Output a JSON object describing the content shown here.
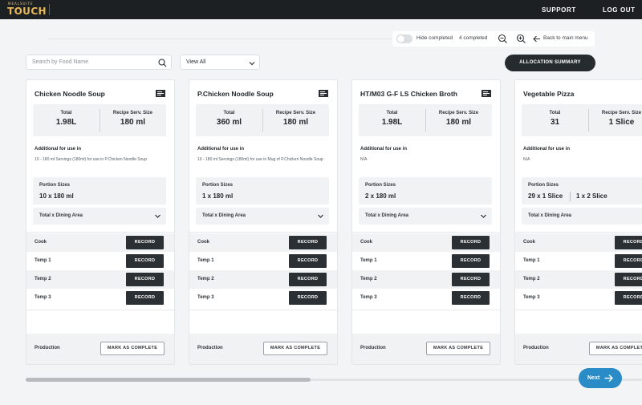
{
  "header": {
    "logo_top": "MEALSUITE",
    "logo_main": "TOUCH",
    "links": [
      "SUPPORT",
      "LOG OUT"
    ]
  },
  "toolbar": {
    "hide_completed": "Hide completed",
    "completed_count": "4 completed",
    "back": "Back to main menu"
  },
  "filters": {
    "search_placeholder": "Search by Food Name",
    "view": "View All",
    "allocation_button": "ALLOCATION SUMMARY"
  },
  "labels": {
    "total": "Total",
    "serv_size": "Recipe Serv. Size",
    "additional": "Additional for use in",
    "portion_sizes": "Portion Sizes",
    "dining": "Total x Dining Area",
    "record": "RECORD",
    "production": "Production",
    "mark_complete": "MARK AS COMPLETE"
  },
  "record_rows": [
    "Cook",
    "Temp 1",
    "Temp 2",
    "Temp 3"
  ],
  "cards": [
    {
      "title": "Chicken Noodle Soup",
      "total": "1.98L",
      "serv_size": "180 ml",
      "additional_text": "10 - 180 ml Servings (180ml) for use in P.Chicken Noodle Soup",
      "portions": [
        "10 x 180 ml"
      ]
    },
    {
      "title": "P.Chicken Noodle Soup",
      "total": "360 ml",
      "serv_size": "180 ml",
      "additional_text": "10 - 180 ml Servings (180ml) for use in Mug of P.Chicken Noodle Soup",
      "portions": [
        "1 x 180 ml"
      ]
    },
    {
      "title": "HT/M03 G-F LS Chicken Broth",
      "total": "1.98L",
      "serv_size": "180 ml",
      "additional_text": "N/A",
      "portions": [
        "2 x 180 ml"
      ]
    },
    {
      "title": "Vegetable Pizza",
      "total": "31",
      "serv_size": "1 Slice",
      "additional_text": "N/A",
      "portions": [
        "29 x 1 Slice",
        "1 x 2 Slice"
      ]
    }
  ],
  "footer": {
    "next": "Next",
    "scroll_position": 0.46
  },
  "colors": {
    "topbar": "#1d2023",
    "logo": "#e6b75a",
    "dark_button": "#2b3035",
    "next_button": "#2a8cc6"
  }
}
